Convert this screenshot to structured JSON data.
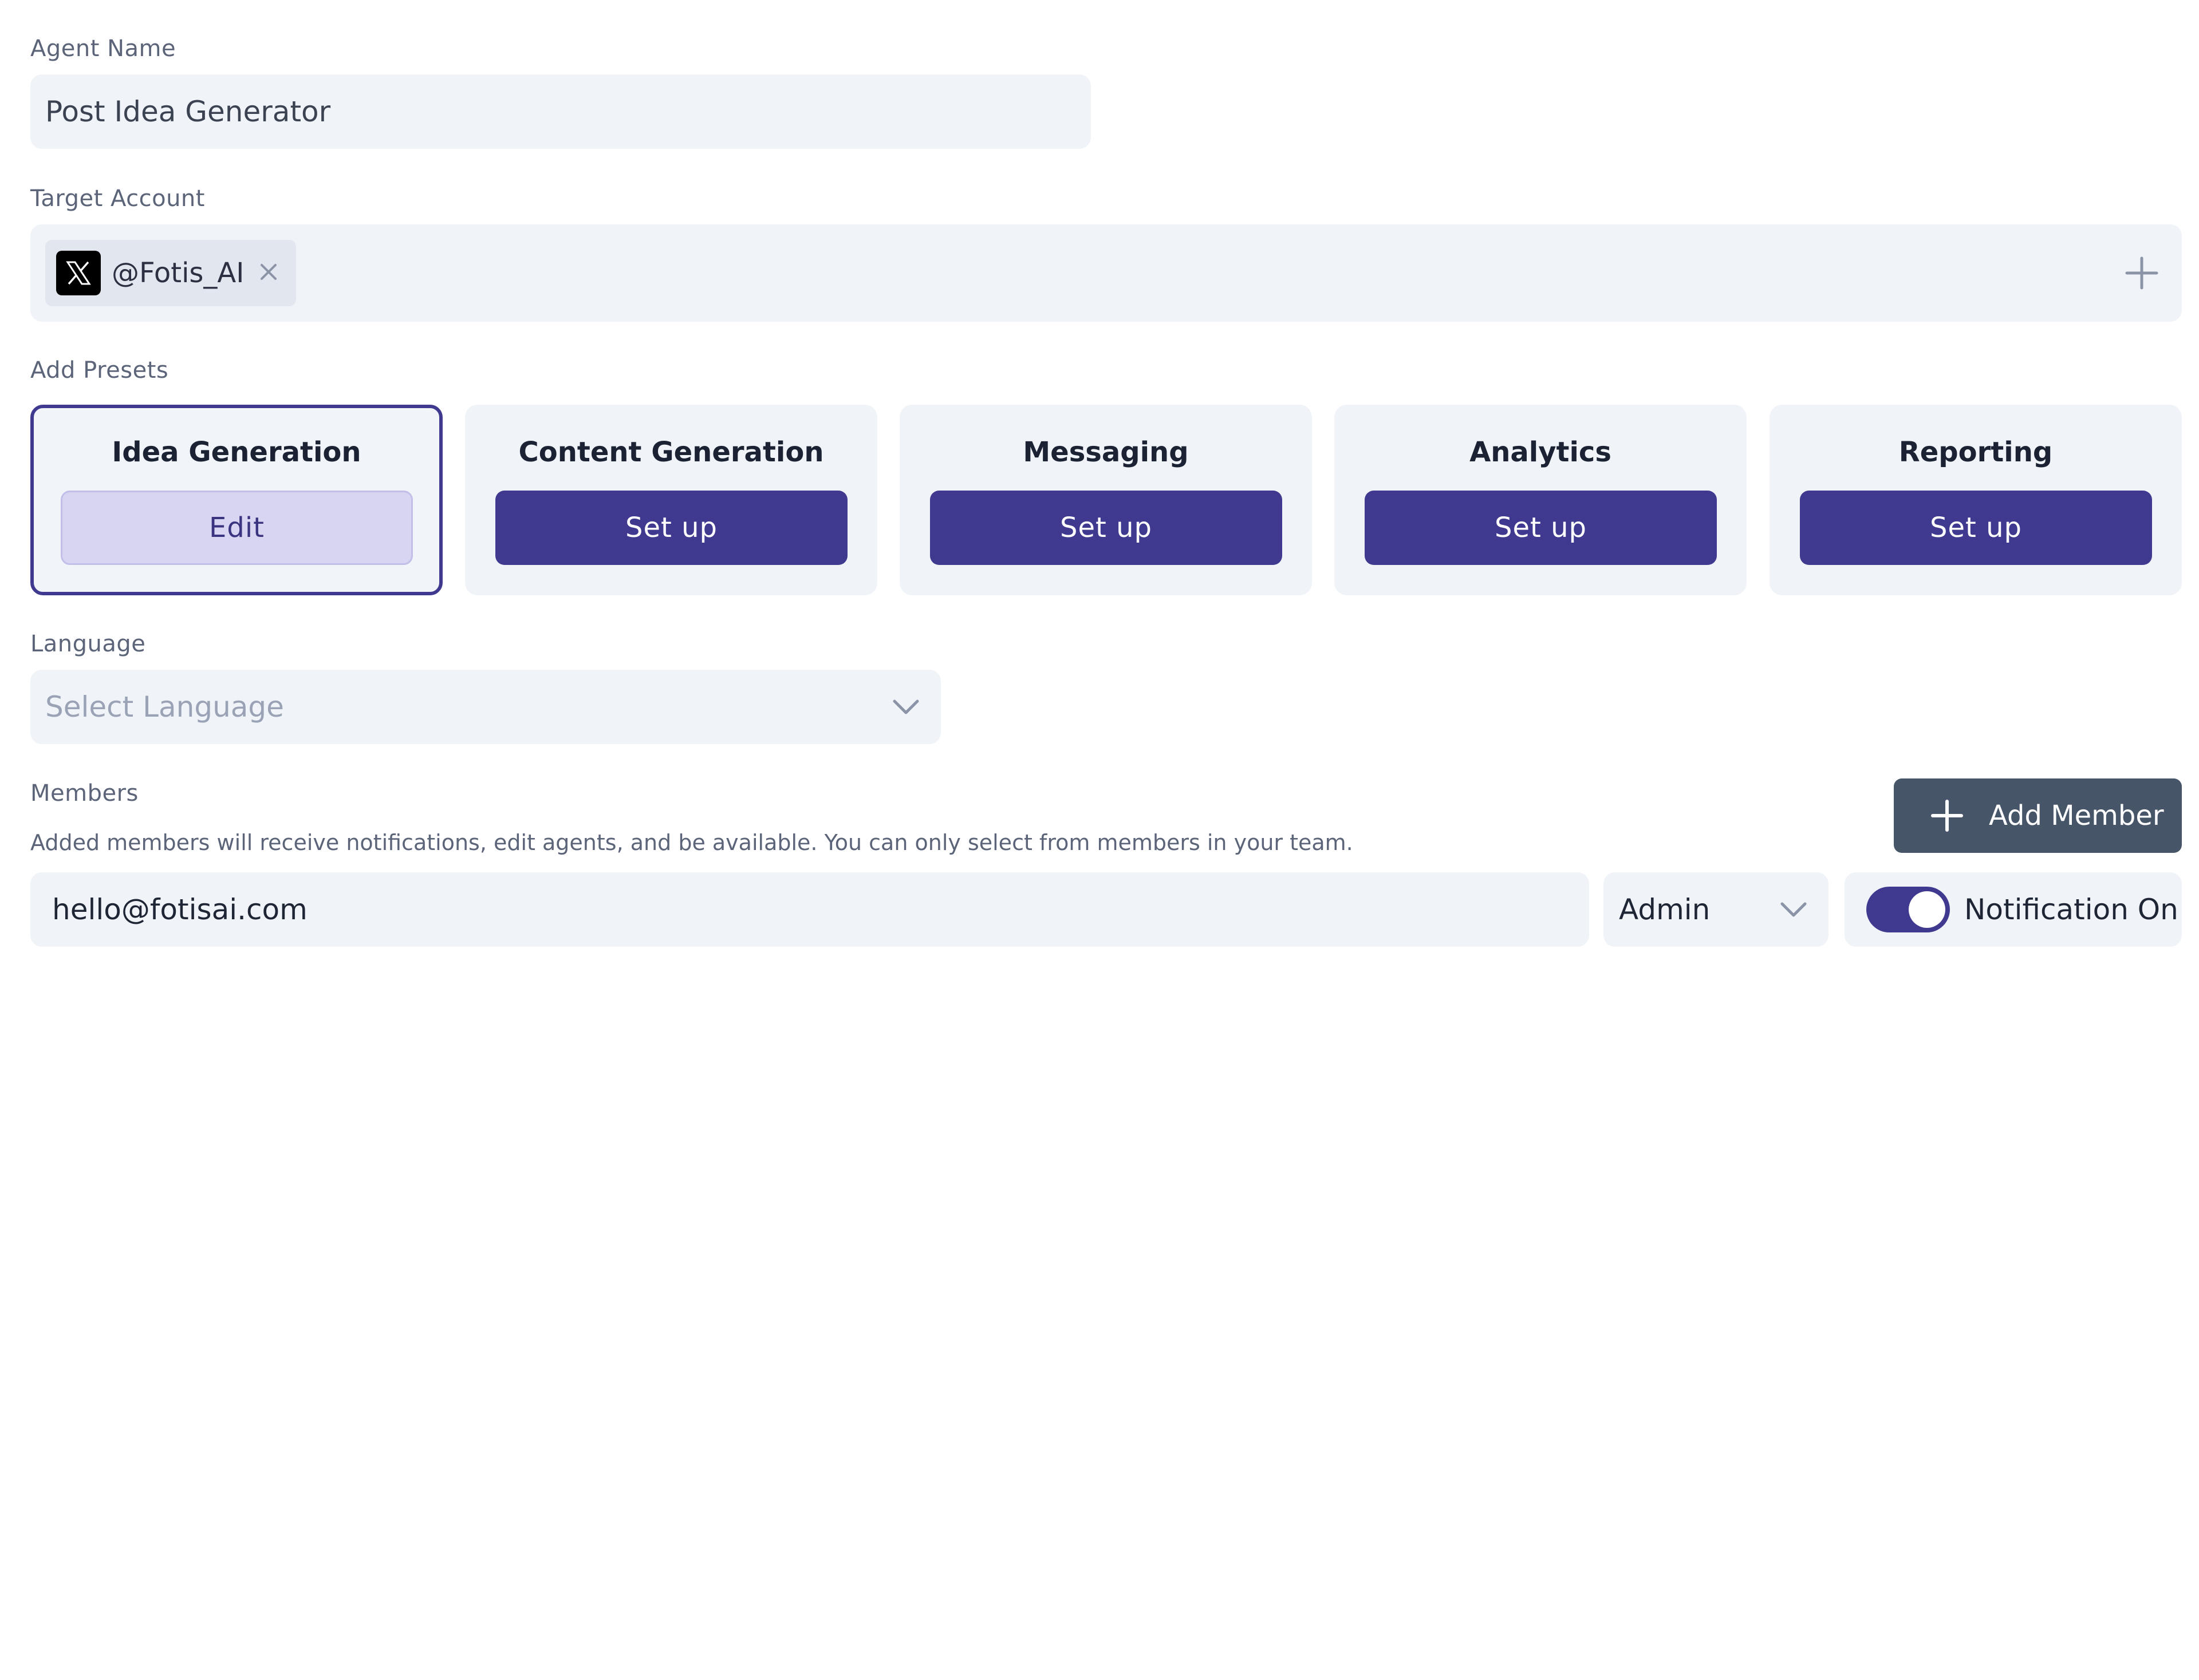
{
  "agent_name": {
    "label": "Agent Name",
    "value": "Post Idea Generator"
  },
  "target_account": {
    "label": "Target Account",
    "accounts": [
      {
        "handle": "@Fotis_AI",
        "platform_icon": "x-logo-icon"
      }
    ],
    "add_icon": "plus-icon",
    "remove_icon": "close-icon"
  },
  "presets": {
    "label": "Add Presets",
    "items": [
      {
        "title": "Idea Generation",
        "button": "Edit",
        "selected": true
      },
      {
        "title": "Content Generation",
        "button": "Set up",
        "selected": false
      },
      {
        "title": "Messaging",
        "button": "Set up",
        "selected": false
      },
      {
        "title": "Analytics",
        "button": "Set up",
        "selected": false
      },
      {
        "title": "Reporting",
        "button": "Set up",
        "selected": false
      }
    ]
  },
  "language": {
    "label": "Language",
    "placeholder": "Select Language",
    "icon": "chevron-down-icon"
  },
  "members": {
    "label": "Members",
    "description": "Added members will receive notifications, edit agents, and be available. You can only select from members in your team.",
    "add_button": "Add Member",
    "rows": [
      {
        "email": "hello@fotisai.com",
        "role": "Admin",
        "notification_label": "Notification On",
        "notification_on": true
      }
    ]
  },
  "colors": {
    "accent": "#3f3a90",
    "accent_light": "#d7d5f1",
    "field_bg": "#f0f3f8",
    "secondary_button": "#475569"
  }
}
